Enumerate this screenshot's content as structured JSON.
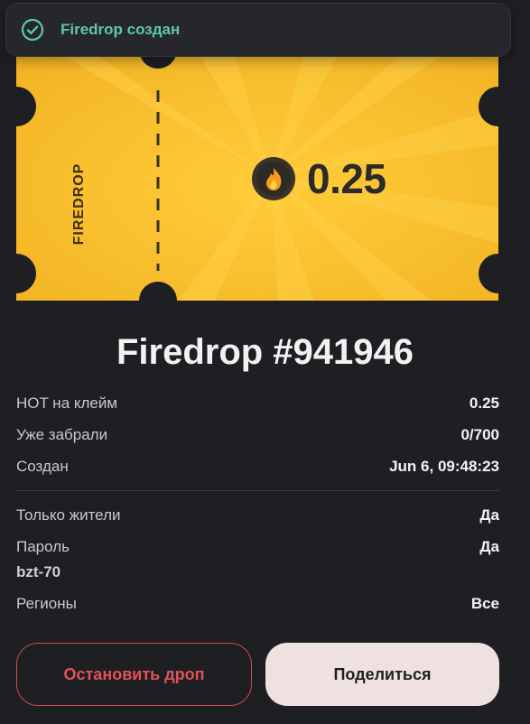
{
  "toast": {
    "text": "Firedrop создан"
  },
  "ticket": {
    "label": "FIREDROP",
    "amount": "0.25"
  },
  "title": "Firedrop #941946",
  "details": {
    "hot_label": "HOT на клейм",
    "hot_value": "0.25",
    "claimed_label": "Уже забрали",
    "claimed_value": "0/700",
    "created_label": "Создан",
    "created_value": "Jun 6, 09:48:23",
    "residents_label": "Только жители",
    "residents_value": "Да",
    "password_label": "Пароль",
    "password_value": "Да",
    "password_hint": "bzt-70",
    "regions_label": "Регионы",
    "regions_value": "Все"
  },
  "buttons": {
    "stop": "Остановить дроп",
    "share": "Поделиться"
  },
  "colors": {
    "ticket": "#f5bb2a",
    "success": "#5ec9a4",
    "danger": "#e25258",
    "share_bg": "#eee1e0"
  }
}
